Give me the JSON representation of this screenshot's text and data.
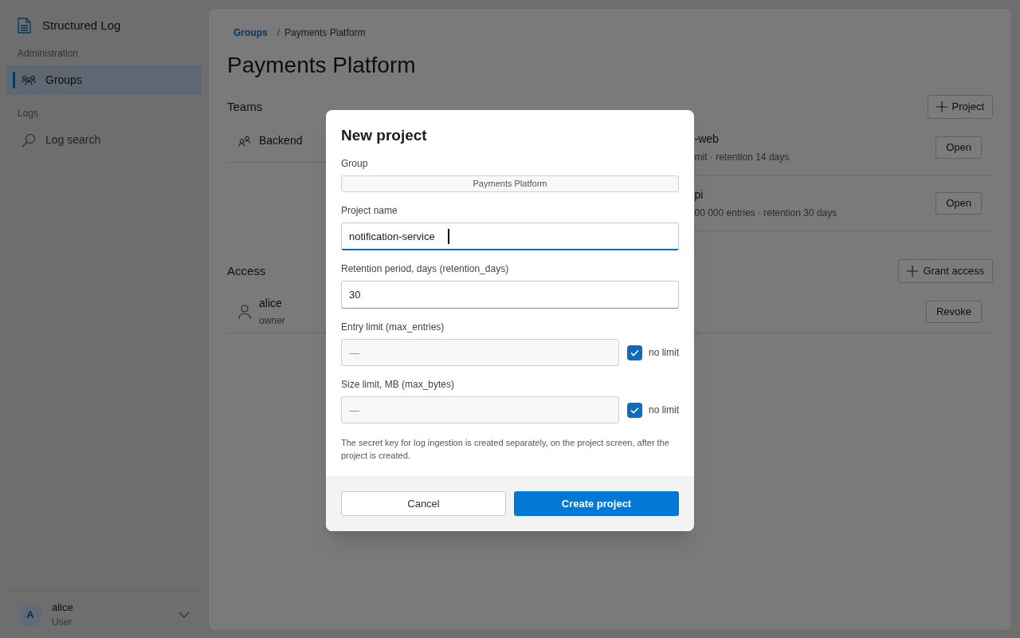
{
  "app": {
    "title": "Structured Log"
  },
  "sidebar": {
    "sections": [
      {
        "heading": "Administration",
        "items": [
          {
            "label": "Groups",
            "kind": "groups",
            "selected": true
          }
        ]
      },
      {
        "heading": "Logs",
        "items": [
          {
            "label": "Log search",
            "kind": "search",
            "selected": false
          }
        ]
      }
    ]
  },
  "user": {
    "avatar": "A",
    "name": "alice",
    "role": "User"
  },
  "breadcrumb": {
    "link": "Groups",
    "separator": "/",
    "current": "Payments Platform"
  },
  "page_title": "Payments Platform",
  "teams": {
    "heading": "Teams",
    "items": [
      {
        "name": "Backend"
      }
    ]
  },
  "projects": {
    "add_button": "Project",
    "items": [
      {
        "name": "-web",
        "meta": "mit · retention 14 days",
        "action": "Open"
      },
      {
        "name": "pi",
        "meta": "00 000 entries · retention 30 days",
        "action": "Open"
      }
    ]
  },
  "access": {
    "heading": "Access",
    "add_button": "Grant access",
    "items": [
      {
        "name": "alice",
        "role": "owner",
        "action": "Revoke"
      }
    ]
  },
  "dialog": {
    "title": "New project",
    "fields": [
      {
        "kind": "readonly",
        "label": "Group",
        "value": "Payments Platform"
      },
      {
        "kind": "text",
        "label": "Project name",
        "value": "notification-service",
        "focused": true
      },
      {
        "kind": "text",
        "label": "Retention period, days (retention_days)",
        "value": "30",
        "focused": false
      },
      {
        "kind": "limit",
        "label": "Entry limit (max_entries)",
        "placeholder": "—",
        "checkbox": {
          "label": "no limit",
          "checked": true
        }
      },
      {
        "kind": "limit",
        "label": "Size limit, MB (max_bytes)",
        "placeholder": "—",
        "checkbox": {
          "label": "no limit",
          "checked": true
        }
      }
    ],
    "note": "The secret key for log ingestion is created separately, on the project screen, after the project is created.",
    "buttons": [
      {
        "label": "Cancel",
        "primary": false
      },
      {
        "label": "Create project",
        "primary": true
      }
    ]
  }
}
